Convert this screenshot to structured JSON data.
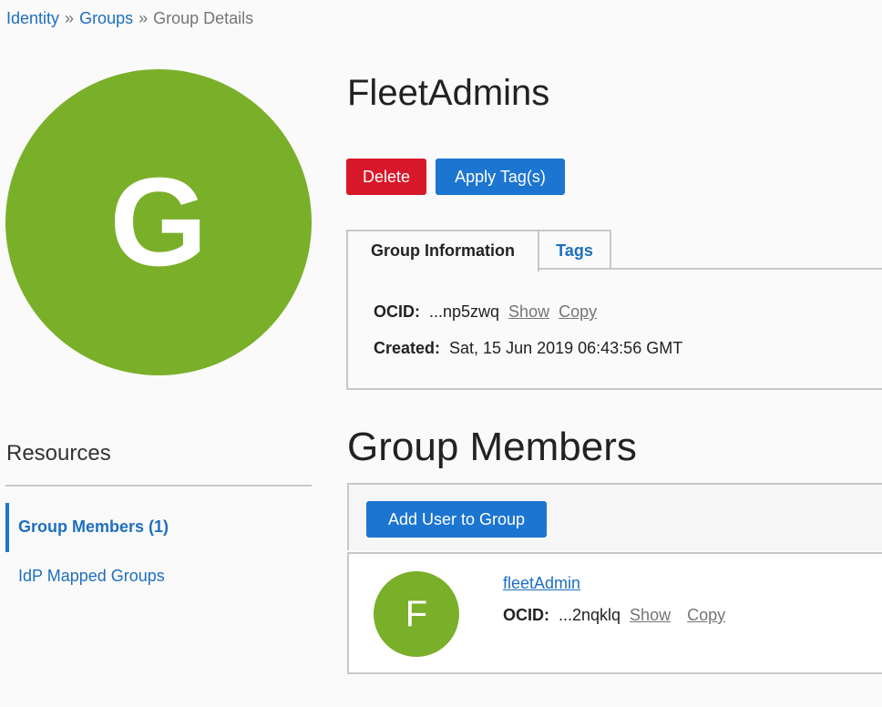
{
  "breadcrumb": {
    "items": [
      "Identity",
      "Groups",
      "Group Details"
    ],
    "separator": "»"
  },
  "group": {
    "avatar_letter": "G",
    "name": "FleetAdmins",
    "avatar_color": "#7aaf2a"
  },
  "actions": {
    "delete_label": "Delete",
    "apply_tags_label": "Apply Tag(s)"
  },
  "tabs": [
    {
      "label": "Group Information",
      "active": true
    },
    {
      "label": "Tags",
      "active": false
    }
  ],
  "info": {
    "ocid_label": "OCID:",
    "ocid_value": "...np5zwq",
    "show_label": "Show",
    "copy_label": "Copy",
    "created_label": "Created:",
    "created_value": "Sat, 15 Jun 2019 06:43:56 GMT"
  },
  "resources": {
    "title": "Resources",
    "items": [
      {
        "label": "Group Members (1)",
        "active": true
      },
      {
        "label": "IdP Mapped Groups",
        "active": false
      }
    ]
  },
  "members": {
    "title": "Group Members",
    "add_button_label": "Add User to Group",
    "list": [
      {
        "avatar_letter": "F",
        "name": "fleetAdmin",
        "ocid_label": "OCID:",
        "ocid_value": "...2nqklq",
        "show_label": "Show",
        "copy_label": "Copy"
      }
    ]
  },
  "colors": {
    "link": "#1e6fc0",
    "primary_button": "#1c75d0",
    "danger_button": "#d7182a"
  }
}
